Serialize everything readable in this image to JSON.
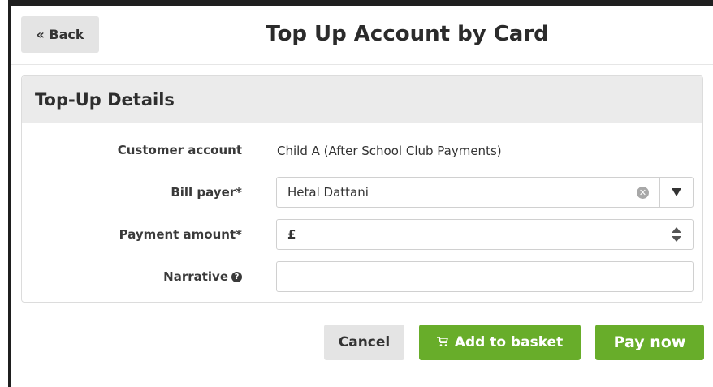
{
  "header": {
    "back_label": "« Back",
    "title": "Top Up Account by Card"
  },
  "panel": {
    "heading": "Top-Up Details",
    "customer_account": {
      "label": "Customer account",
      "value": "Child A (After School Club Payments)"
    },
    "bill_payer": {
      "label": "Bill payer*",
      "value": "Hetal Dattani"
    },
    "payment_amount": {
      "label": "Payment amount*",
      "currency_symbol": "£",
      "value": ""
    },
    "narrative": {
      "label": "Narrative",
      "value": ""
    }
  },
  "actions": {
    "cancel_label": "Cancel",
    "add_to_basket_label": "Add to basket",
    "pay_now_label": "Pay now"
  },
  "icons": {
    "clear": "clear-icon",
    "dropdown": "chevron-down-icon",
    "spinner": "spinner-icon",
    "help": "help-icon",
    "cart": "cart-icon"
  },
  "colors": {
    "primary_green": "#68ad2a",
    "neutral_button": "#e4e4e4",
    "panel_heading_bg": "#ebebeb"
  }
}
